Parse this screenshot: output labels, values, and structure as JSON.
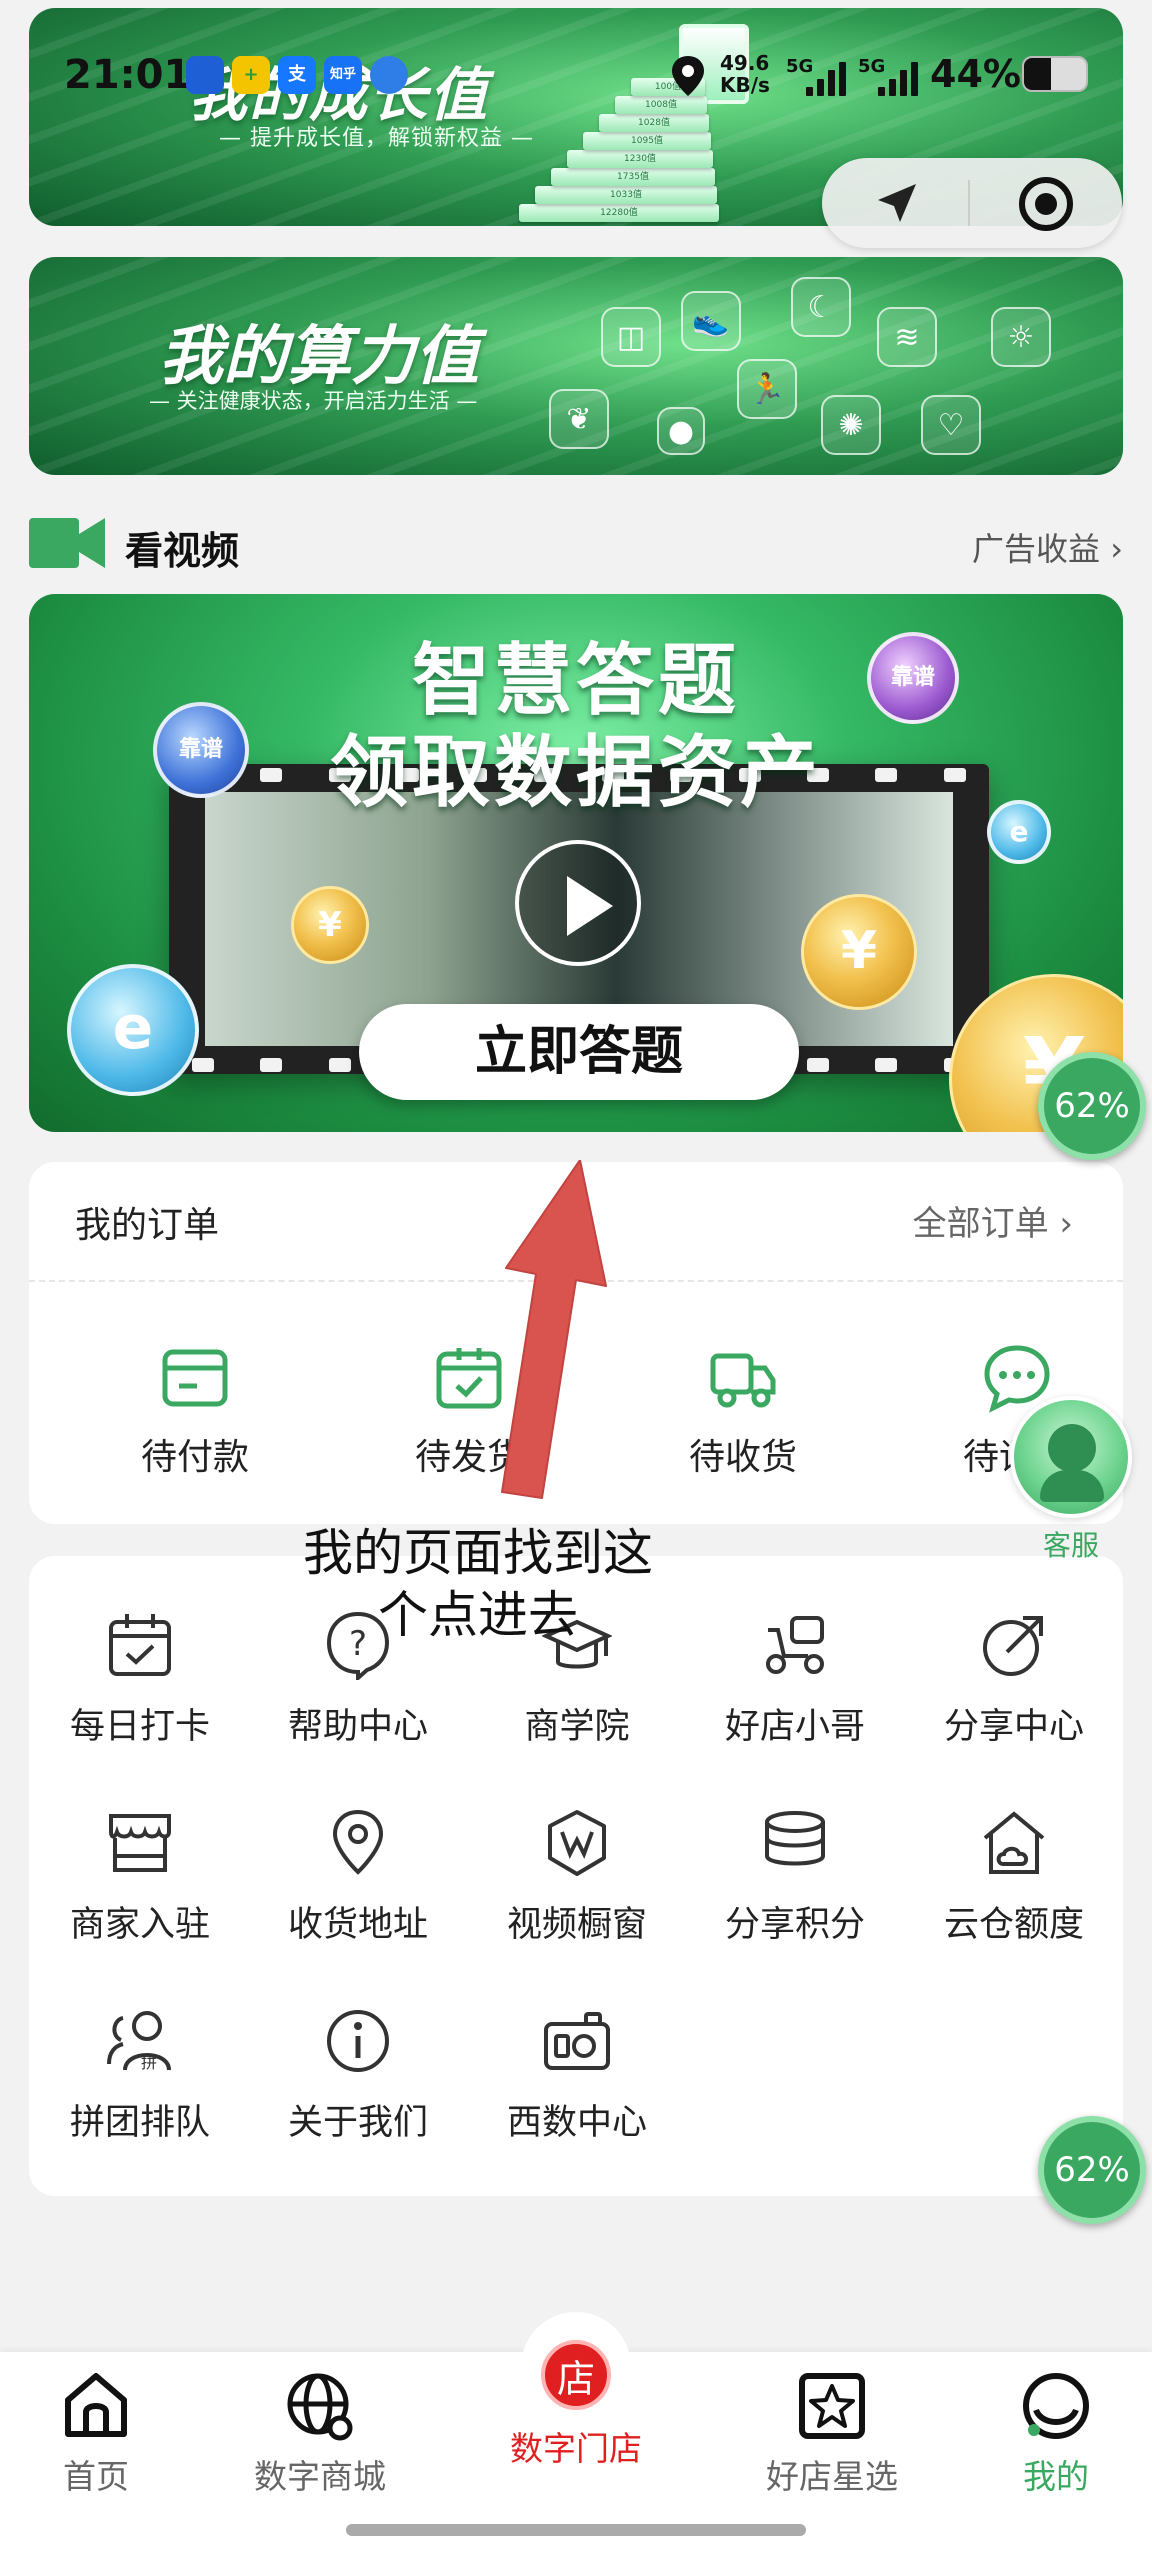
{
  "status_bar": {
    "time": "21:01",
    "speed_value": "49.6",
    "speed_unit": "KB/s",
    "net1": "5G",
    "net2": "5G",
    "battery": "44%",
    "battery_level": 0.44,
    "app_icons": [
      "shield-icon",
      "plus-icon",
      "alipay-icon",
      "zhihu-icon",
      "app-icon"
    ],
    "app_icon_labels": [
      "",
      "+",
      "支",
      "知乎",
      ""
    ]
  },
  "banner_growth": {
    "title": "我的成长值",
    "subtitle": "— 提升成长值，解锁新权益 —",
    "steps": [
      "12280值",
      "1033值",
      "1735值",
      "1230值",
      "1095值",
      "1028值",
      "1008值",
      "100值"
    ]
  },
  "banner_compute": {
    "title": "我的算力值",
    "subtitle": "— 关注健康状态，开启活力生活 —"
  },
  "video_section": {
    "title": "看视频",
    "link": "广告收益 ›",
    "card_line1": "智慧答题",
    "card_line2": "领取数据资产",
    "button": "立即答题",
    "orb_label": "靠谱",
    "coin_symbol": "¥"
  },
  "orders": {
    "title": "我的订单",
    "link": "全部订单 ›",
    "items": [
      {
        "label": "待付款",
        "icon": "wallet-card-icon"
      },
      {
        "label": "待发货",
        "icon": "package-check-icon"
      },
      {
        "label": "待收货",
        "icon": "truck-icon"
      },
      {
        "label": "待评价",
        "icon": "chat-bubble-icon"
      }
    ]
  },
  "tools": [
    {
      "label": "每日打卡",
      "icon": "calendar-check-icon"
    },
    {
      "label": "帮助中心",
      "icon": "help-circle-icon"
    },
    {
      "label": "商学院",
      "icon": "graduation-cap-icon"
    },
    {
      "label": "好店小哥",
      "icon": "delivery-scooter-icon"
    },
    {
      "label": "分享中心",
      "icon": "share-arrow-icon"
    },
    {
      "label": "商家入驻",
      "icon": "storefront-icon"
    },
    {
      "label": "收货地址",
      "icon": "location-pin-icon"
    },
    {
      "label": "视频橱窗",
      "icon": "video-window-icon"
    },
    {
      "label": "分享积分",
      "icon": "coin-stack-icon"
    },
    {
      "label": "云仓额度",
      "icon": "cloud-warehouse-icon"
    },
    {
      "label": "拼团排队",
      "icon": "group-queue-icon"
    },
    {
      "label": "关于我们",
      "icon": "info-circle-icon"
    },
    {
      "label": "西数中心",
      "icon": "camera-icon"
    }
  ],
  "annotation": {
    "line1": "我的页面找到这",
    "line2": "个点进去"
  },
  "customer_service": {
    "label": "客服"
  },
  "progress_badges": [
    {
      "label": "62%",
      "value": 0.62
    },
    {
      "label": "62%",
      "value": 0.62
    }
  ],
  "bottom_nav": [
    {
      "label": "首页",
      "icon": "home-icon"
    },
    {
      "label": "数字商城",
      "icon": "globe-shop-icon"
    },
    {
      "label": "数字门店",
      "icon": "store-badge-icon",
      "badge": "店"
    },
    {
      "label": "好店星选",
      "icon": "star-box-icon"
    },
    {
      "label": "我的",
      "icon": "profile-smile-icon",
      "active": true
    }
  ],
  "colors": {
    "brand_green": "#3aa860",
    "center_red": "#e02020",
    "icon_green": "#3aa860",
    "annotation_arrow": "#d9534f"
  }
}
